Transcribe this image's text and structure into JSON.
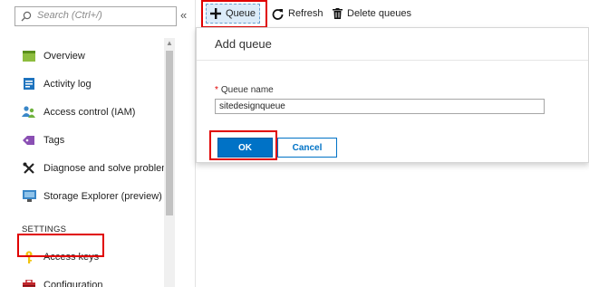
{
  "search": {
    "placeholder": "Search (Ctrl+/)"
  },
  "collapse": {
    "glyph": "«"
  },
  "nav": {
    "items": [
      {
        "label": "Overview",
        "icon": "overview-icon"
      },
      {
        "label": "Activity log",
        "icon": "activity-log-icon"
      },
      {
        "label": "Access control (IAM)",
        "icon": "access-control-icon"
      },
      {
        "label": "Tags",
        "icon": "tag-icon"
      },
      {
        "label": "Diagnose and solve problems",
        "icon": "wrench-icon"
      },
      {
        "label": "Storage Explorer (preview)",
        "icon": "storage-explorer-icon"
      }
    ],
    "section": "SETTINGS",
    "settings_items": [
      {
        "label": "Access keys",
        "icon": "key-icon"
      },
      {
        "label": "Configuration",
        "icon": "toolbox-icon"
      }
    ]
  },
  "toolbar": {
    "queue_label": "Queue",
    "refresh_label": "Refresh",
    "delete_label": "Delete queues"
  },
  "dialog": {
    "title": "Add queue",
    "field_required_marker": "*",
    "field_label": "Queue name",
    "field_value": "sitedesignqueue",
    "ok_label": "OK",
    "cancel_label": "Cancel"
  },
  "colors": {
    "accent": "#0072c6",
    "highlight": "#e00000",
    "active_tab_bg": "#dcecf9"
  }
}
